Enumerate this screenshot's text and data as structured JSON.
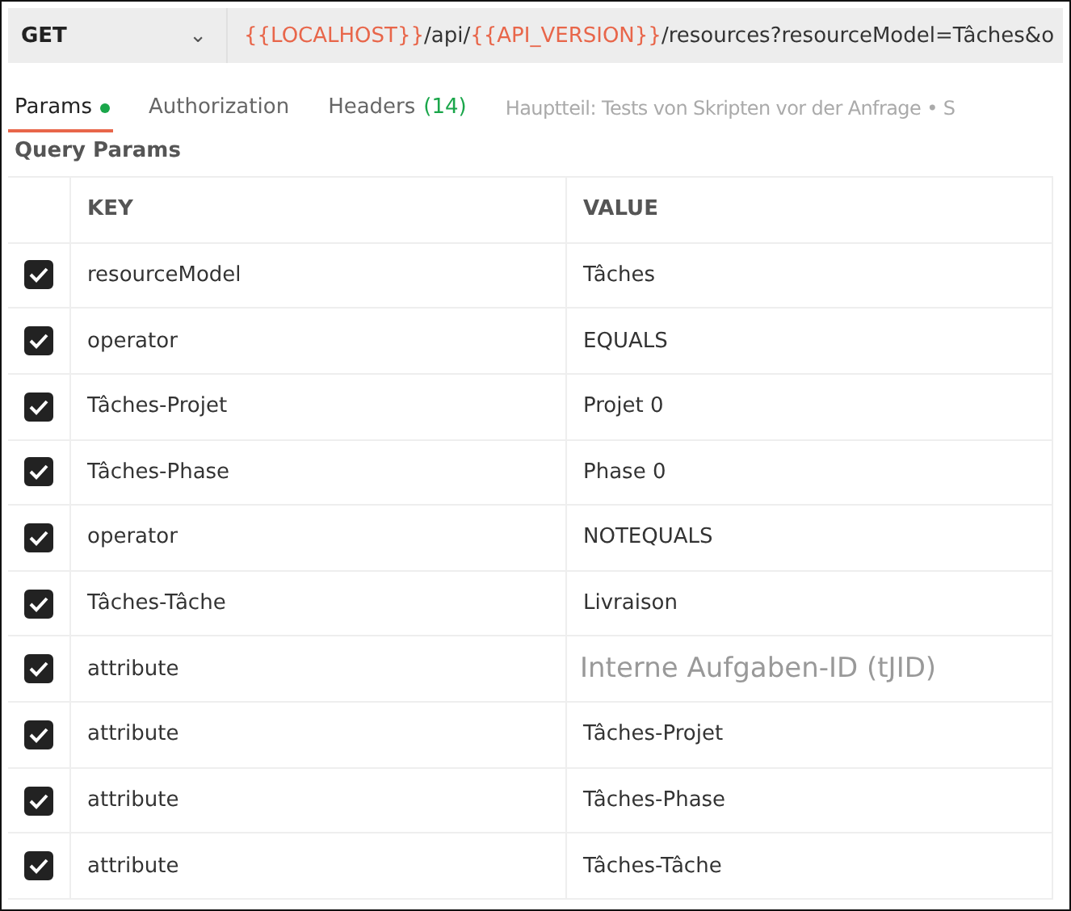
{
  "request": {
    "method": "GET",
    "caret": "⌄",
    "url": [
      {
        "kind": "variable",
        "text": "{{LOCALHOST}}"
      },
      {
        "kind": "text",
        "text": "/api/"
      },
      {
        "kind": "variable",
        "text": "{{API_VERSION}}"
      },
      {
        "kind": "text",
        "text": "/resources?resourceModel=Tâches&o"
      }
    ]
  },
  "tabs": [
    {
      "label": "Params",
      "selected": true,
      "dot": true
    },
    {
      "label": "Authorization",
      "selected": false,
      "dot": false
    },
    {
      "label": "Headers",
      "count": "(14)",
      "selected": false,
      "dot": false
    }
  ],
  "tabs_overflow": "Hauptteil: Tests von Skripten vor der Anfrage • S",
  "section_title": "Query Params",
  "table": {
    "columns": [
      "KEY",
      "VALUE"
    ],
    "rows": [
      {
        "checked": true,
        "key": "resourceModel",
        "value": "Tâches",
        "kind": "plain"
      },
      {
        "checked": true,
        "key": "operator",
        "value": "EQUALS",
        "kind": "plain"
      },
      {
        "checked": true,
        "key": "Tâches-Projet",
        "value": "Projet 0",
        "kind": "plain"
      },
      {
        "checked": true,
        "key": "Tâches-Phase",
        "value": "Phase 0",
        "kind": "plain"
      },
      {
        "checked": true,
        "key": "operator",
        "value": "NOTEQUALS",
        "kind": "plain"
      },
      {
        "checked": true,
        "key": "Tâches-Tâche",
        "value": "Livraison",
        "kind": "plain"
      },
      {
        "checked": true,
        "key": "attribute",
        "value": "Interne Aufgaben-ID (tJID)",
        "kind": "translated"
      },
      {
        "checked": true,
        "key": "attribute",
        "value": "Tâches-Projet",
        "kind": "plain"
      },
      {
        "checked": true,
        "key": "attribute",
        "value": "Tâches-Phase",
        "kind": "plain"
      },
      {
        "checked": true,
        "key": "attribute",
        "value": "Tâches-Tâche",
        "kind": "plain"
      }
    ]
  }
}
